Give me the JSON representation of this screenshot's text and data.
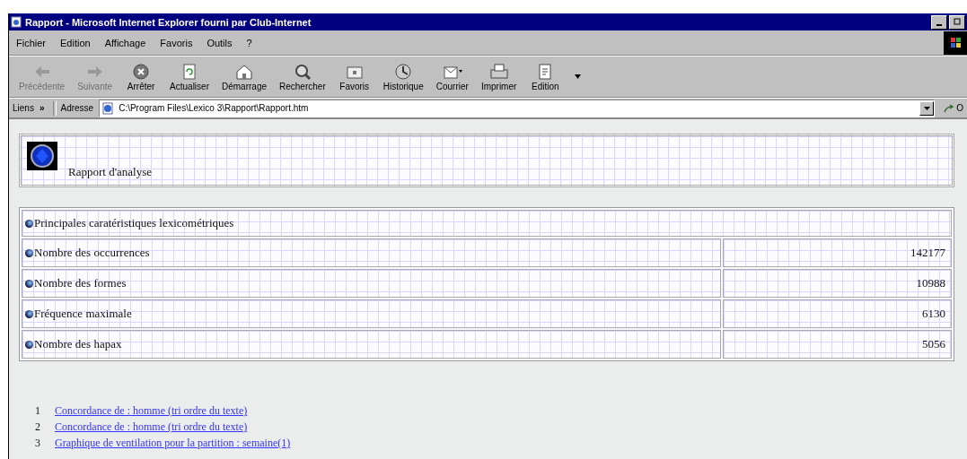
{
  "window": {
    "title": "Rapport - Microsoft Internet Explorer fourni par Club-Internet"
  },
  "menu": [
    "Fichier",
    "Edition",
    "Affichage",
    "Favoris",
    "Outils",
    "?"
  ],
  "toolbar": [
    {
      "label": "Précédente",
      "kind": "back",
      "disabled": true
    },
    {
      "label": "Suivante",
      "kind": "forward",
      "disabled": true
    },
    {
      "label": "Arrêter",
      "kind": "stop",
      "disabled": false
    },
    {
      "label": "Actualiser",
      "kind": "refresh",
      "disabled": false
    },
    {
      "label": "Démarrage",
      "kind": "home",
      "disabled": false
    },
    {
      "label": "Rechercher",
      "kind": "search",
      "disabled": false
    },
    {
      "label": "Favoris",
      "kind": "favorites",
      "disabled": false
    },
    {
      "label": "Historique",
      "kind": "history",
      "disabled": false
    },
    {
      "label": "Courrier",
      "kind": "mail",
      "disabled": false
    },
    {
      "label": "Imprimer",
      "kind": "print",
      "disabled": false
    },
    {
      "label": "Edition",
      "kind": "edit",
      "disabled": false
    }
  ],
  "address_bar": {
    "links_label": "Liens",
    "chevron": "»",
    "label": "Adresse",
    "value": "C:\\Program Files\\Lexico 3\\Rapport\\Rapport.htm",
    "go": "O"
  },
  "report": {
    "title": "Rapport d'analyse",
    "section": "Principales caratéristiques lexicométriques",
    "rows": [
      {
        "label": "Nombre des occurrences",
        "value": "142177"
      },
      {
        "label": "Nombre des formes",
        "value": "10988"
      },
      {
        "label": "Fréquence maximale",
        "value": "6130"
      },
      {
        "label": "Nombre des hapax",
        "value": "5056"
      }
    ]
  },
  "links": [
    {
      "number": "1",
      "text": "Concordance de : homme (tri ordre du texte)"
    },
    {
      "number": "2",
      "text": "Concordance de : homme (tri ordre du texte)"
    },
    {
      "number": "3",
      "text": "Graphique de ventilation pour la partition : semaine(1)"
    }
  ]
}
